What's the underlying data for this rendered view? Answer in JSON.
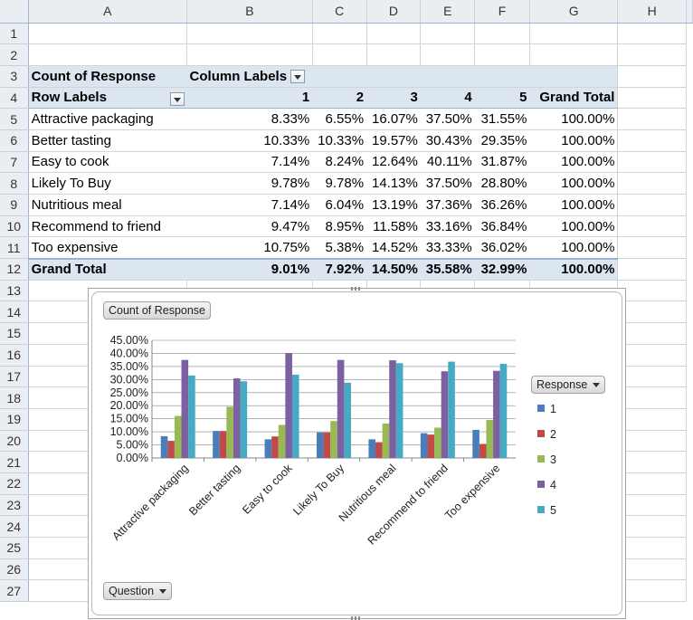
{
  "columns": [
    "A",
    "B",
    "C",
    "D",
    "E",
    "F",
    "G",
    "H"
  ],
  "rows": [
    "1",
    "2",
    "3",
    "4",
    "5",
    "6",
    "7",
    "8",
    "9",
    "10",
    "11",
    "12",
    "13",
    "14",
    "15",
    "16",
    "17",
    "18",
    "19",
    "20",
    "21",
    "22",
    "23",
    "24",
    "25",
    "26",
    "27"
  ],
  "pivot": {
    "count_label": "Count of Response",
    "column_labels": "Column Labels",
    "row_labels": "Row Labels",
    "col_headers": [
      "1",
      "2",
      "3",
      "4",
      "5",
      "Grand Total"
    ],
    "data_rows": [
      {
        "label": "Attractive packaging",
        "values": [
          "8.33%",
          "6.55%",
          "16.07%",
          "37.50%",
          "31.55%",
          "100.00%"
        ]
      },
      {
        "label": "Better tasting",
        "values": [
          "10.33%",
          "10.33%",
          "19.57%",
          "30.43%",
          "29.35%",
          "100.00%"
        ]
      },
      {
        "label": "Easy to cook",
        "values": [
          "7.14%",
          "8.24%",
          "12.64%",
          "40.11%",
          "31.87%",
          "100.00%"
        ]
      },
      {
        "label": "Likely To Buy",
        "values": [
          "9.78%",
          "9.78%",
          "14.13%",
          "37.50%",
          "28.80%",
          "100.00%"
        ]
      },
      {
        "label": "Nutritious meal",
        "values": [
          "7.14%",
          "6.04%",
          "13.19%",
          "37.36%",
          "36.26%",
          "100.00%"
        ]
      },
      {
        "label": "Recommend to friend",
        "values": [
          "9.47%",
          "8.95%",
          "11.58%",
          "33.16%",
          "36.84%",
          "100.00%"
        ]
      },
      {
        "label": "Too expensive",
        "values": [
          "10.75%",
          "5.38%",
          "14.52%",
          "33.33%",
          "36.02%",
          "100.00%"
        ]
      }
    ],
    "grand_total": {
      "label": "Grand Total",
      "values": [
        "9.01%",
        "7.92%",
        "14.50%",
        "35.58%",
        "32.99%",
        "100.00%"
      ]
    }
  },
  "chart_buttons": {
    "value_field": "Count of Response",
    "legend_field": "Response",
    "axis_field": "Question"
  },
  "chart_data": {
    "type": "bar",
    "categories": [
      "Attractive packaging",
      "Better tasting",
      "Easy to cook",
      "Likely To Buy",
      "Nutritious meal",
      "Recommend to friend",
      "Too expensive"
    ],
    "series": [
      {
        "name": "1",
        "color": "#4a7ebb",
        "values": [
          8.33,
          10.33,
          7.14,
          9.78,
          7.14,
          9.47,
          10.75
        ]
      },
      {
        "name": "2",
        "color": "#be4b48",
        "values": [
          6.55,
          10.33,
          8.24,
          9.78,
          6.04,
          8.95,
          5.38
        ]
      },
      {
        "name": "3",
        "color": "#98b954",
        "values": [
          16.07,
          19.57,
          12.64,
          14.13,
          13.19,
          11.58,
          14.52
        ]
      },
      {
        "name": "4",
        "color": "#7d60a0",
        "values": [
          37.5,
          30.43,
          40.11,
          37.5,
          37.36,
          33.16,
          33.33
        ]
      },
      {
        "name": "5",
        "color": "#46aac5",
        "values": [
          31.55,
          29.35,
          31.87,
          28.8,
          36.26,
          36.84,
          36.02
        ]
      }
    ],
    "ylim": [
      0,
      45
    ],
    "yticks": [
      "0.00%",
      "5.00%",
      "10.00%",
      "15.00%",
      "20.00%",
      "25.00%",
      "30.00%",
      "35.00%",
      "40.00%",
      "45.00%"
    ],
    "grid": true,
    "legend": "right"
  }
}
